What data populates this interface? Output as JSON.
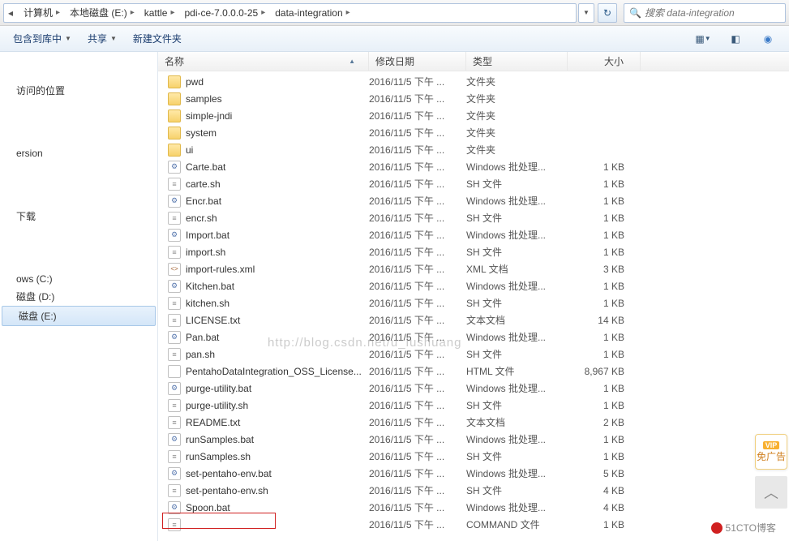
{
  "breadcrumbs": {
    "items": [
      "计算机",
      "本地磁盘 (E:)",
      "kattle",
      "pdi-ce-7.0.0.0-25",
      "data-integration"
    ]
  },
  "search": {
    "placeholder": "搜索 data-integration"
  },
  "toolbar": {
    "include": "包含到库中",
    "share": "共享",
    "newfolder": "新建文件夹"
  },
  "sidebar": {
    "recent": "访问的位置",
    "ersion": "ersion",
    "downloads": "下载",
    "ows_c": "ows  (C:)",
    "disk_d": "磁盘 (D:)",
    "disk_e": "磁盘 (E:)"
  },
  "columns": {
    "name": "名称",
    "date": "修改日期",
    "type": "类型",
    "size": "大小"
  },
  "files": [
    {
      "name": "pwd",
      "date": "2016/11/5 下午 ...",
      "type": "文件夹",
      "size": "",
      "icon": "folder"
    },
    {
      "name": "samples",
      "date": "2016/11/5 下午 ...",
      "type": "文件夹",
      "size": "",
      "icon": "folder"
    },
    {
      "name": "simple-jndi",
      "date": "2016/11/5 下午 ...",
      "type": "文件夹",
      "size": "",
      "icon": "folder"
    },
    {
      "name": "system",
      "date": "2016/11/5 下午 ...",
      "type": "文件夹",
      "size": "",
      "icon": "folder"
    },
    {
      "name": "ui",
      "date": "2016/11/5 下午 ...",
      "type": "文件夹",
      "size": "",
      "icon": "folder"
    },
    {
      "name": "Carte.bat",
      "date": "2016/11/5 下午 ...",
      "type": "Windows 批处理...",
      "size": "1 KB",
      "icon": "bat"
    },
    {
      "name": "carte.sh",
      "date": "2016/11/5 下午 ...",
      "type": "SH 文件",
      "size": "1 KB",
      "icon": "sh"
    },
    {
      "name": "Encr.bat",
      "date": "2016/11/5 下午 ...",
      "type": "Windows 批处理...",
      "size": "1 KB",
      "icon": "bat"
    },
    {
      "name": "encr.sh",
      "date": "2016/11/5 下午 ...",
      "type": "SH 文件",
      "size": "1 KB",
      "icon": "sh"
    },
    {
      "name": "Import.bat",
      "date": "2016/11/5 下午 ...",
      "type": "Windows 批处理...",
      "size": "1 KB",
      "icon": "bat"
    },
    {
      "name": "import.sh",
      "date": "2016/11/5 下午 ...",
      "type": "SH 文件",
      "size": "1 KB",
      "icon": "sh"
    },
    {
      "name": "import-rules.xml",
      "date": "2016/11/5 下午 ...",
      "type": "XML 文档",
      "size": "3 KB",
      "icon": "xml"
    },
    {
      "name": "Kitchen.bat",
      "date": "2016/11/5 下午 ...",
      "type": "Windows 批处理...",
      "size": "1 KB",
      "icon": "bat"
    },
    {
      "name": "kitchen.sh",
      "date": "2016/11/5 下午 ...",
      "type": "SH 文件",
      "size": "1 KB",
      "icon": "sh"
    },
    {
      "name": "LICENSE.txt",
      "date": "2016/11/5 下午 ...",
      "type": "文本文档",
      "size": "14 KB",
      "icon": "txt"
    },
    {
      "name": "Pan.bat",
      "date": "2016/11/5 下午 ...",
      "type": "Windows 批处理...",
      "size": "1 KB",
      "icon": "bat"
    },
    {
      "name": "pan.sh",
      "date": "2016/11/5 下午 ...",
      "type": "SH 文件",
      "size": "1 KB",
      "icon": "sh"
    },
    {
      "name": "PentahoDataIntegration_OSS_License...",
      "date": "2016/11/5 下午 ...",
      "type": "HTML 文件",
      "size": "8,967 KB",
      "icon": "html"
    },
    {
      "name": "purge-utility.bat",
      "date": "2016/11/5 下午 ...",
      "type": "Windows 批处理...",
      "size": "1 KB",
      "icon": "bat"
    },
    {
      "name": "purge-utility.sh",
      "date": "2016/11/5 下午 ...",
      "type": "SH 文件",
      "size": "1 KB",
      "icon": "sh"
    },
    {
      "name": "README.txt",
      "date": "2016/11/5 下午 ...",
      "type": "文本文档",
      "size": "2 KB",
      "icon": "txt"
    },
    {
      "name": "runSamples.bat",
      "date": "2016/11/5 下午 ...",
      "type": "Windows 批处理...",
      "size": "1 KB",
      "icon": "bat"
    },
    {
      "name": "runSamples.sh",
      "date": "2016/11/5 下午 ...",
      "type": "SH 文件",
      "size": "1 KB",
      "icon": "sh"
    },
    {
      "name": "set-pentaho-env.bat",
      "date": "2016/11/5 下午 ...",
      "type": "Windows 批处理...",
      "size": "5 KB",
      "icon": "bat"
    },
    {
      "name": "set-pentaho-env.sh",
      "date": "2016/11/5 下午 ...",
      "type": "SH 文件",
      "size": "4 KB",
      "icon": "sh"
    },
    {
      "name": "Spoon.bat",
      "date": "2016/11/5 下午 ...",
      "type": "Windows 批处理...",
      "size": "4 KB",
      "icon": "bat"
    },
    {
      "name": "",
      "date": "2016/11/5 下午 ...",
      "type": "COMMAND 文件",
      "size": "1 KB",
      "icon": "sh"
    }
  ],
  "vip": {
    "label1": "VIP",
    "label2": "免广告"
  },
  "footer_watermark": "51CTO博客",
  "center_watermark": "http://blog.csdn.net/u_lushuang"
}
